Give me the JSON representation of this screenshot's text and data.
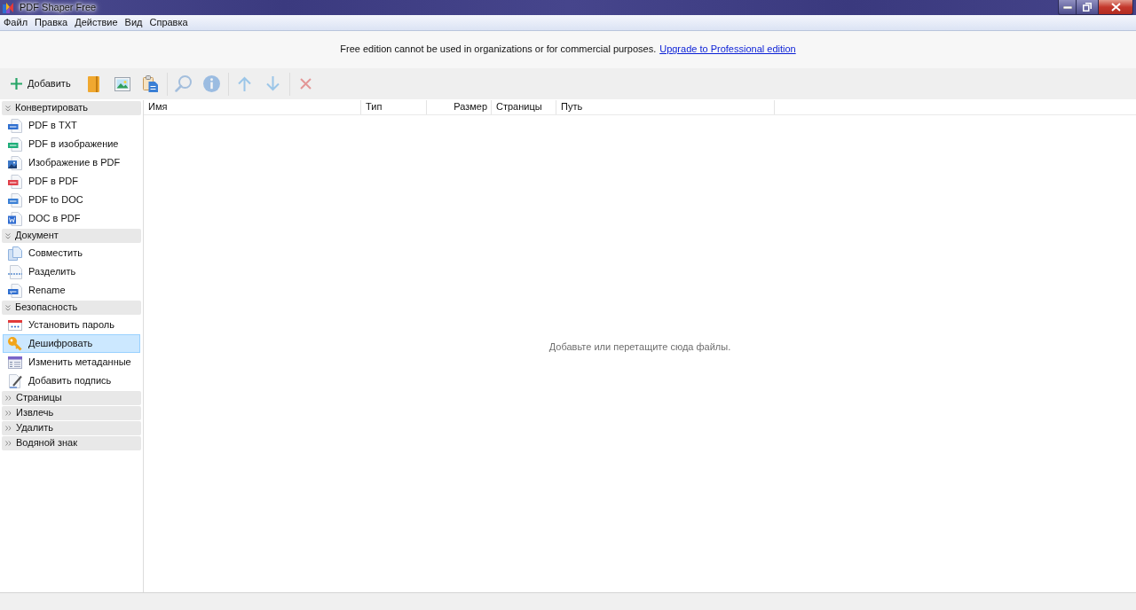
{
  "window": {
    "title": "PDF Shaper Free"
  },
  "menu": [
    "Файл",
    "Правка",
    "Действие",
    "Вид",
    "Справка"
  ],
  "notice": {
    "text": "Free edition cannot be used in organizations or for commercial purposes.",
    "link": "Upgrade to Professional edition"
  },
  "toolbar": {
    "add_button": {
      "label": "Добавить"
    },
    "groups": [
      [
        {
          "disabled": false
        },
        {
          "disabled": false
        },
        {
          "disabled": false
        }
      ],
      [
        {
          "disabled": true
        },
        {
          "disabled": true
        }
      ],
      [
        {
          "disabled": true
        },
        {
          "disabled": true
        }
      ],
      [
        {
          "disabled": true
        }
      ]
    ]
  },
  "sidebar": {
    "groups": [
      {
        "title": "Конвертировать",
        "expanded": true,
        "items": [
          {
            "label": "PDF в TXT",
            "selected": false
          },
          {
            "label": "PDF в изображение",
            "selected": false
          },
          {
            "label": "Изображение в PDF",
            "selected": false
          },
          {
            "label": "PDF в PDF",
            "selected": false
          },
          {
            "label": "PDF to DOC",
            "selected": false
          },
          {
            "label": "DOC в PDF",
            "selected": false
          }
        ]
      },
      {
        "title": "Документ",
        "expanded": true,
        "items": [
          {
            "label": "Совместить",
            "selected": false
          },
          {
            "label": "Разделить",
            "selected": false
          },
          {
            "label": "Rename",
            "selected": false
          }
        ]
      },
      {
        "title": "Безопасность",
        "expanded": true,
        "items": [
          {
            "label": "Установить пароль",
            "selected": false
          },
          {
            "label": "Дешифровать",
            "selected": true
          },
          {
            "label": "Изменить метаданные",
            "selected": false
          },
          {
            "label": "Добавить подпись",
            "selected": false
          }
        ]
      },
      {
        "title": "Страницы",
        "expanded": false
      },
      {
        "title": "Извлечь",
        "expanded": false
      },
      {
        "title": "Удалить",
        "expanded": false
      },
      {
        "title": "Водяной знак",
        "expanded": false
      }
    ]
  },
  "file_list": {
    "columns": [
      "Имя",
      "Тип",
      "Размер",
      "Страницы",
      "Путь"
    ],
    "empty_message": "Добавьте или перетащите сюда файлы."
  }
}
